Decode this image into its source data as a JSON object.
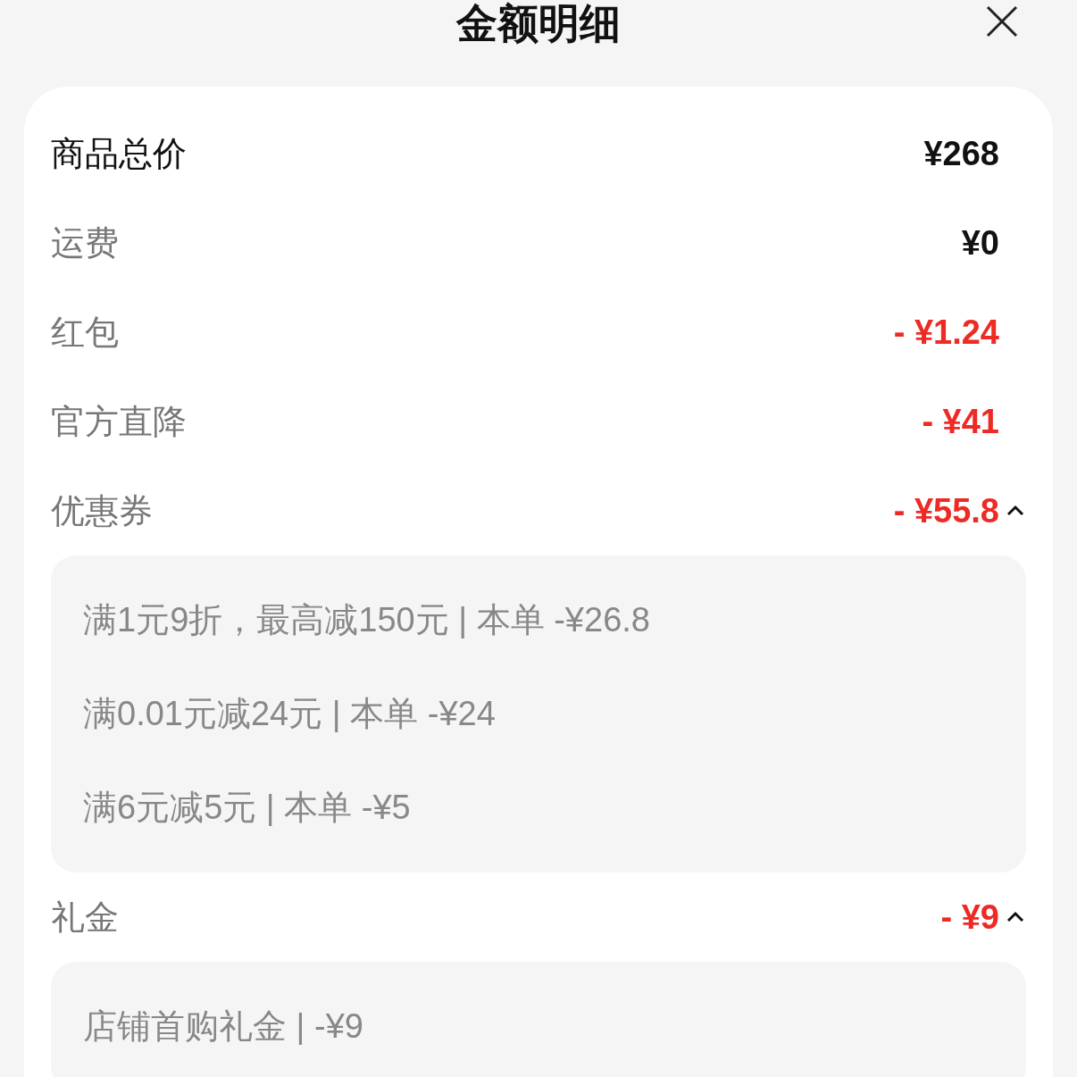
{
  "header": {
    "title": "金额明细"
  },
  "rows": [
    {
      "kind": "total",
      "label": "商品总价",
      "value": "¥268"
    },
    {
      "kind": "charge",
      "label": "运费",
      "value": "¥0"
    },
    {
      "kind": "discount",
      "label": "红包",
      "value": "- ¥1.24"
    },
    {
      "kind": "discount",
      "label": "官方直降",
      "value": "- ¥41"
    },
    {
      "kind": "group",
      "label": "优惠券",
      "value": "- ¥55.8",
      "expanded": true,
      "details": [
        "满1元9折，最高减150元 | 本单 -¥26.8",
        "满0.01元减24元 | 本单 -¥24",
        "满6元减5元 | 本单 -¥5"
      ]
    },
    {
      "kind": "group",
      "label": "礼金",
      "value": "- ¥9",
      "expanded": true,
      "details": [
        "店铺首购礼金 | -¥9"
      ]
    }
  ]
}
